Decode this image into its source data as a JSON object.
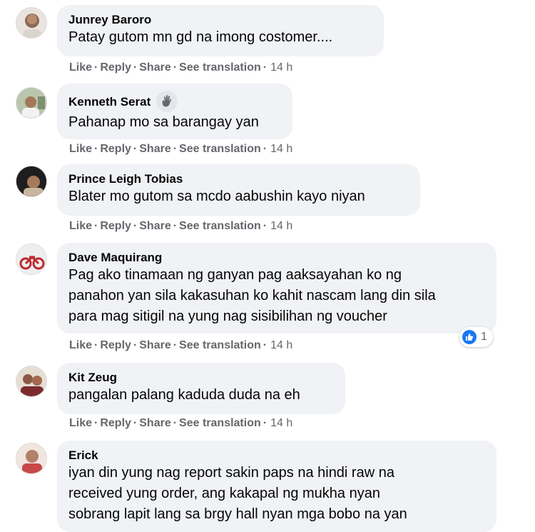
{
  "actions": {
    "like": "Like",
    "reply": "Reply",
    "share": "Share",
    "see_translation": "See translation",
    "separator": "·"
  },
  "comments": [
    {
      "author": "Junrey Baroro",
      "text": "Patay gutom mn gd na imong costomer....",
      "time": "14 h"
    },
    {
      "author": "Kenneth Serat",
      "badge_icon": "waving-hand-icon",
      "text": "Pahanap mo sa barangay yan",
      "time": "14 h"
    },
    {
      "author": "Prince Leigh Tobias",
      "text": "Blater mo gutom sa mcdo aabushin kayo niyan",
      "time": "14 h"
    },
    {
      "author": "Dave Maquirang",
      "text": "Pag ako tinamaan ng ganyan pag aaksayahan ko ng\npanahon yan sila kakasuhan ko kahit nascam lang din sila\npara mag sitigil na yung nag sisibilihan ng voucher",
      "time": "14 h",
      "reaction": {
        "icon": "like-reaction-icon",
        "count": "1"
      }
    },
    {
      "author": "Kit Zeug",
      "text": "pangalan palang kaduda duda na eh",
      "time": "14 h"
    },
    {
      "author": "Erick",
      "text": "iyan din yung nag report sakin paps na hindi raw na\nreceived yung order, ang kakapal ng mukha nyan\nsobrang lapit lang sa brgy hall nyan mga bobo na yan"
    }
  ],
  "colors": {
    "bubble": "#f0f2f5",
    "meta": "#65676b",
    "like_blue": "#1877f2"
  }
}
